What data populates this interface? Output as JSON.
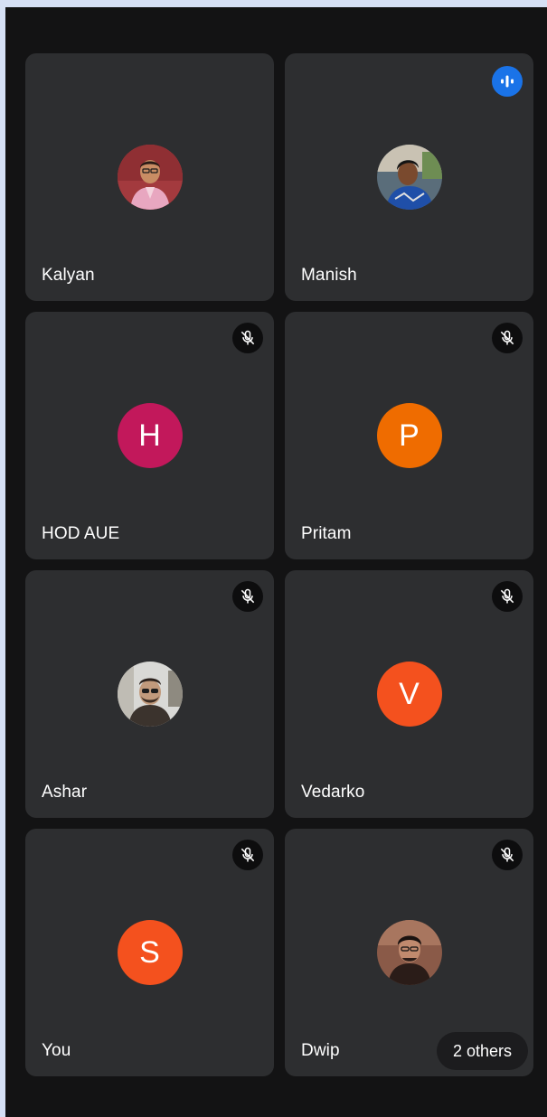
{
  "colors": {
    "page_border": "#d6e0f5",
    "background": "#131314",
    "tile": "#2d2e30",
    "speaking_accent": "#1a73e8",
    "mute_badge": "#0d0d0e"
  },
  "participants": [
    {
      "name": "Kalyan",
      "avatar_type": "photo",
      "icon": "speaking-none",
      "muted": false
    },
    {
      "name": "Manish",
      "avatar_type": "photo",
      "speaking": true,
      "muted": false,
      "speaking_icon": "audio-level-icon"
    },
    {
      "name": "HOD AUE",
      "avatar_type": "initial",
      "initial": "H",
      "avatar_color": "#c2185b",
      "muted": true,
      "mute_icon": "mic-off-icon"
    },
    {
      "name": "Pritam",
      "avatar_type": "initial",
      "initial": "P",
      "avatar_color": "#ef6c00",
      "muted": true,
      "mute_icon": "mic-off-icon"
    },
    {
      "name": "Ashar",
      "avatar_type": "photo",
      "muted": true,
      "mute_icon": "mic-off-icon"
    },
    {
      "name": "Vedarko",
      "avatar_type": "initial",
      "initial": "V",
      "avatar_color": "#f4511e",
      "muted": true,
      "mute_icon": "mic-off-icon"
    },
    {
      "name": "You",
      "avatar_type": "initial",
      "initial": "S",
      "avatar_color": "#f4511e",
      "muted": true,
      "mute_icon": "mic-off-icon"
    },
    {
      "name": "Dwip",
      "avatar_type": "photo",
      "muted": true,
      "mute_icon": "mic-off-icon"
    }
  ],
  "others_button": {
    "label": "2 others"
  }
}
